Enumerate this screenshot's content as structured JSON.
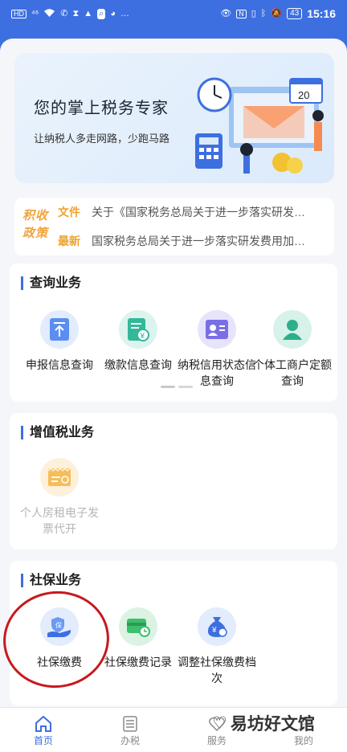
{
  "status_bar": {
    "left_icons": [
      "HD",
      "4G",
      "wifi-icon",
      "phone-icon",
      "hourglass-icon",
      "signal-icon",
      "search-icon",
      "qq-icon",
      "more-icon"
    ],
    "left_text": [
      "HD",
      "⁴⁶",
      "…"
    ],
    "battery": "43",
    "time": "15:16"
  },
  "banner": {
    "title": "您的掌上税务专家",
    "subtitle": "让纳税人多走网路，少跑马路",
    "calendar_day": "20"
  },
  "notice": {
    "badge_line1": "积收",
    "badge_line2": "政策",
    "items": [
      {
        "tag": "文件",
        "text": "关于《国家税务总局关于进一步落实研发…"
      },
      {
        "tag": "最新",
        "text": "国家税务总局关于进一步落实研发费用加…"
      }
    ]
  },
  "query_section": {
    "title": "查询业务",
    "tiles": [
      {
        "label": "申报信息查询",
        "icon": "upload-doc-icon"
      },
      {
        "label": "缴款信息查询",
        "icon": "yuan-doc-icon"
      },
      {
        "label": "纳税信用状态信息查询",
        "icon": "id-card-icon"
      },
      {
        "label": "个体工商户定额查询",
        "icon": "person-icon"
      }
    ]
  },
  "vat_section": {
    "title": "增值税业务",
    "tiles": [
      {
        "label": "个人房租电子发票代开",
        "icon": "invoice-icon",
        "disabled": true
      }
    ]
  },
  "social_section": {
    "title": "社保业务",
    "tiles": [
      {
        "label": "社保缴费",
        "icon": "insurance-hand-icon"
      },
      {
        "label": "社保缴费记录",
        "icon": "card-clock-icon"
      },
      {
        "label": "调整社保缴费档次",
        "icon": "money-bag-icon"
      }
    ]
  },
  "bottom_nav": {
    "items": [
      {
        "label": "首页",
        "icon": "home-icon",
        "active": true
      },
      {
        "label": "办税",
        "icon": "list-icon",
        "active": false
      },
      {
        "label": "服务",
        "icon": "heart-icon",
        "active": false
      },
      {
        "label": "我的",
        "icon": "user-icon",
        "active": false
      }
    ]
  },
  "watermark": {
    "text": "易坊好文馆"
  },
  "colors": {
    "brand_blue": "#3d6fe0",
    "notice_orange": "#f0a22c",
    "highlight_red": "#c7191d"
  }
}
